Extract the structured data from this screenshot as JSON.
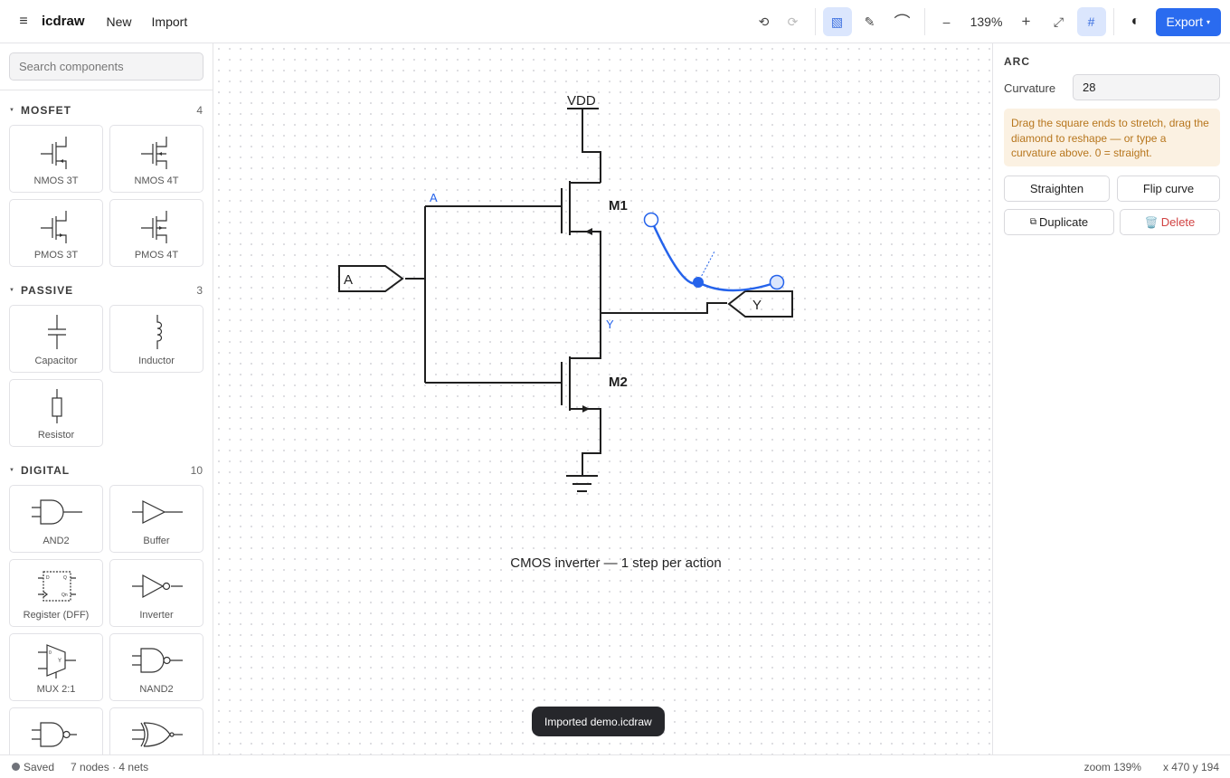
{
  "topbar": {
    "menu_icon": "≡",
    "app_title": "icdraw",
    "new_label": "New",
    "import_label": "Import",
    "undo_icon": "⟲",
    "redo_icon": "⟳",
    "select_icon": "▧",
    "pen_icon": "✎",
    "arc_icon": "⌒",
    "zoom_out_icon": "–",
    "zoom_value": "139%",
    "zoom_in_icon": "+",
    "fit_icon": "⤢",
    "grid_icon": "#",
    "theme_icon": "◐",
    "export_label": "Export",
    "export_caret": "▾"
  },
  "sidebar": {
    "search_placeholder": "Search components",
    "categories": [
      {
        "name": "MOSFET",
        "count": "4",
        "items": [
          {
            "label": "NMOS 3T",
            "icon": "nmos-3t-icon"
          },
          {
            "label": "NMOS 4T",
            "icon": "nmos-4t-icon"
          },
          {
            "label": "PMOS 3T",
            "icon": "pmos-3t-icon"
          },
          {
            "label": "PMOS 4T",
            "icon": "pmos-4t-icon"
          }
        ]
      },
      {
        "name": "PASSIVE",
        "count": "3",
        "items": [
          {
            "label": "Capacitor",
            "icon": "capacitor-icon"
          },
          {
            "label": "Inductor",
            "icon": "inductor-icon"
          },
          {
            "label": "Resistor",
            "icon": "resistor-icon"
          }
        ]
      },
      {
        "name": "DIGITAL",
        "count": "10",
        "items": [
          {
            "label": "AND2",
            "icon": "and-gate-icon"
          },
          {
            "label": "Buffer",
            "icon": "buffer-icon"
          },
          {
            "label": "Register (DFF)",
            "icon": "register-icon"
          },
          {
            "label": "Inverter",
            "icon": "inverter-icon"
          },
          {
            "label": "MUX 2:1",
            "icon": "mux-icon"
          },
          {
            "label": "NAND2",
            "icon": "nand-gate-icon"
          }
        ]
      }
    ]
  },
  "canvas": {
    "vdd_label": "VDD",
    "m1_label": "M1",
    "m2_label": "M2",
    "net_a_label": "A",
    "net_y_label": "Y",
    "port_a_label": "A",
    "port_y_label": "Y",
    "caption": "CMOS inverter — 1 step per action",
    "toast": "Imported demo.icdraw",
    "accent_color": "#2563eb"
  },
  "panel": {
    "title": "ARC",
    "curvature_label": "Curvature",
    "curvature_value": "28",
    "hint": "Drag the square ends to stretch, drag the diamond to reshape — or type a curvature above. 0 = straight.",
    "straighten_label": "Straighten",
    "flip_label": "Flip curve",
    "duplicate_icon": "⧉",
    "duplicate_label": "Duplicate",
    "delete_icon": "🗑️",
    "delete_label": "Delete"
  },
  "status": {
    "saved": "Saved",
    "counts": "7 nodes · 4 nets",
    "zoom": "zoom 139%",
    "coords": "x 470 y 194"
  }
}
